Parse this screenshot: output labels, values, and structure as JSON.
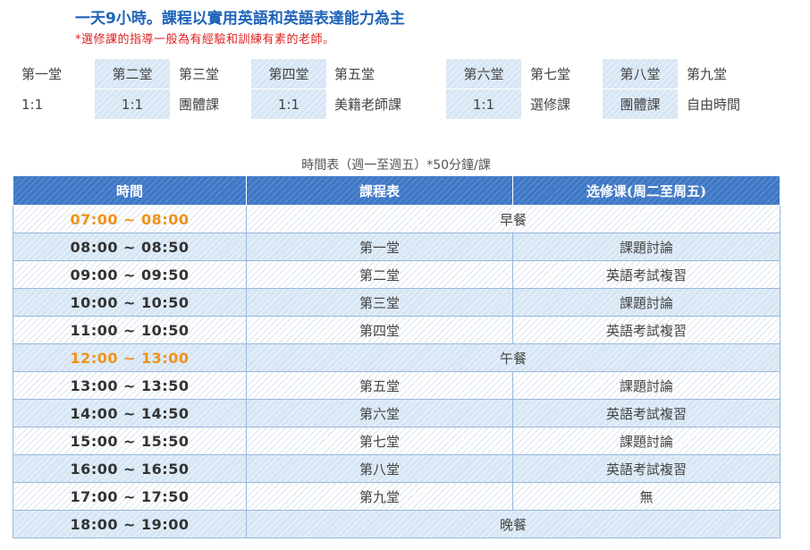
{
  "header": {
    "title": "一天9小時。課程以實用英語和英語表達能力為主",
    "note": "*選修課的指導一般為有經驗和訓練有素的老師。"
  },
  "periods": [
    {
      "label": "第一堂",
      "type": "1:1"
    },
    {
      "label": "第二堂",
      "type": "1:1"
    },
    {
      "label": "第三堂",
      "type": "團體課"
    },
    {
      "label": "第四堂",
      "type": "1:1"
    },
    {
      "label": "第五堂",
      "type": "美籍老師課"
    },
    {
      "label": "第六堂",
      "type": "1:1"
    },
    {
      "label": "第七堂",
      "type": "選修課"
    },
    {
      "label": "第八堂",
      "type": "團體課"
    },
    {
      "label": "第九堂",
      "type": "自由時間"
    }
  ],
  "schedule": {
    "caption": "時間表（週一至週五）*50分鐘/課",
    "headers": [
      "時間",
      "課程表",
      "选修课(周二至周五)"
    ],
    "rows": [
      {
        "time": "07:00 ~ 08:00",
        "course": "早餐",
        "elective": "",
        "meal": true
      },
      {
        "time": "08:00 ~ 08:50",
        "course": "第一堂",
        "elective": "課題討論",
        "meal": false
      },
      {
        "time": "09:00 ~ 09:50",
        "course": "第二堂",
        "elective": "英語考試複習",
        "meal": false
      },
      {
        "time": "10:00 ~ 10:50",
        "course": "第三堂",
        "elective": "課題討論",
        "meal": false
      },
      {
        "time": "11:00 ~ 10:50",
        "course": "第四堂",
        "elective": "英語考試複習",
        "meal": false
      },
      {
        "time": "12:00 ~ 13:00",
        "course": "午餐",
        "elective": "",
        "meal": true
      },
      {
        "time": "13:00 ~ 13:50",
        "course": "第五堂",
        "elective": "課題討論",
        "meal": false
      },
      {
        "time": "14:00 ~ 14:50",
        "course": "第六堂",
        "elective": "英語考試複習",
        "meal": false
      },
      {
        "time": "15:00 ~ 15:50",
        "course": "第七堂",
        "elective": "課題討論",
        "meal": false
      },
      {
        "time": "16:00 ~ 16:50",
        "course": "第八堂",
        "elective": "英語考試複習",
        "meal": false
      },
      {
        "time": "17:00 ~ 17:50",
        "course": "第九堂",
        "elective": "無",
        "meal": false
      },
      {
        "time": "18:00 ~ 19:00",
        "course": "晚餐",
        "elective": "",
        "meal": false
      }
    ]
  },
  "colors": {
    "title": "#1f63b8",
    "note": "#e02020",
    "header_bg": "#3f78c6",
    "meal_time": "#f0921a",
    "stripe": "#d7e6f5"
  }
}
